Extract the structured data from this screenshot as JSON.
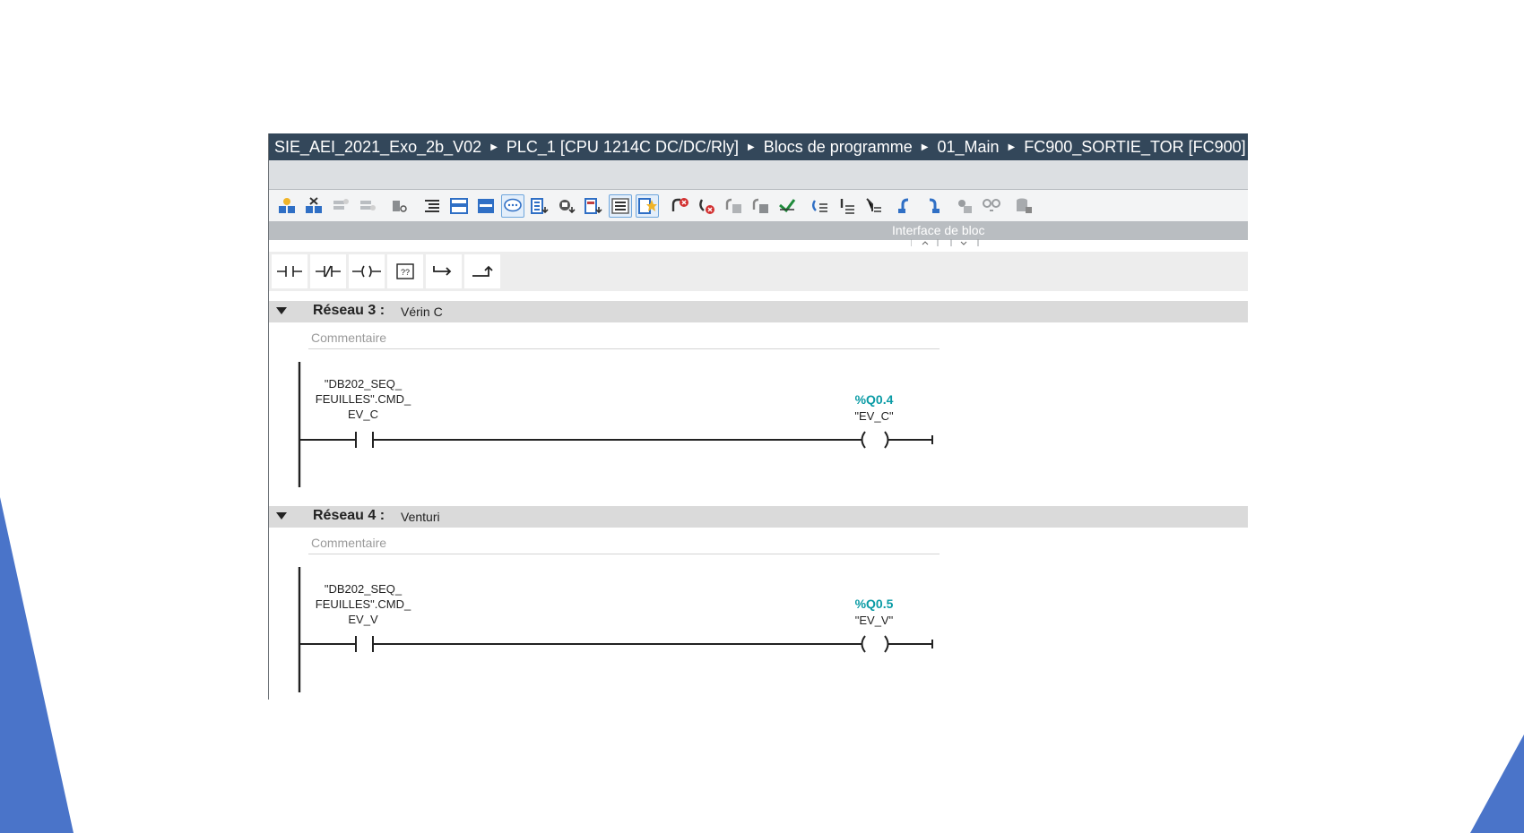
{
  "breadcrumb": {
    "segments": [
      "SIE_AEI_2021_Exo_2b_V02",
      "PLC_1 [CPU 1214C DC/DC/Rly]",
      "Blocs de programme",
      "01_Main",
      "FC900_SORTIE_TOR [FC900]"
    ]
  },
  "interface_label": "Interface de bloc",
  "networks": [
    {
      "title": "Réseau 3 :",
      "name": "Vérin C",
      "comment_placeholder": "Commentaire",
      "contact_operand": [
        "\"DB202_SEQ_",
        "FEUILLES\".CMD_",
        "EV_C"
      ],
      "coil_address": "%Q0.4",
      "coil_tag": "\"EV_C\""
    },
    {
      "title": "Réseau 4 :",
      "name": "Venturi",
      "comment_placeholder": "Commentaire",
      "contact_operand": [
        "\"DB202_SEQ_",
        "FEUILLES\".CMD_",
        "EV_V"
      ],
      "coil_address": "%Q0.5",
      "coil_tag": "\"EV_V\""
    }
  ],
  "colors": {
    "breadcrumb_bg": "#33475a",
    "address_teal": "#0a9ba5",
    "slide_accent_blue": "#4a74c9"
  }
}
